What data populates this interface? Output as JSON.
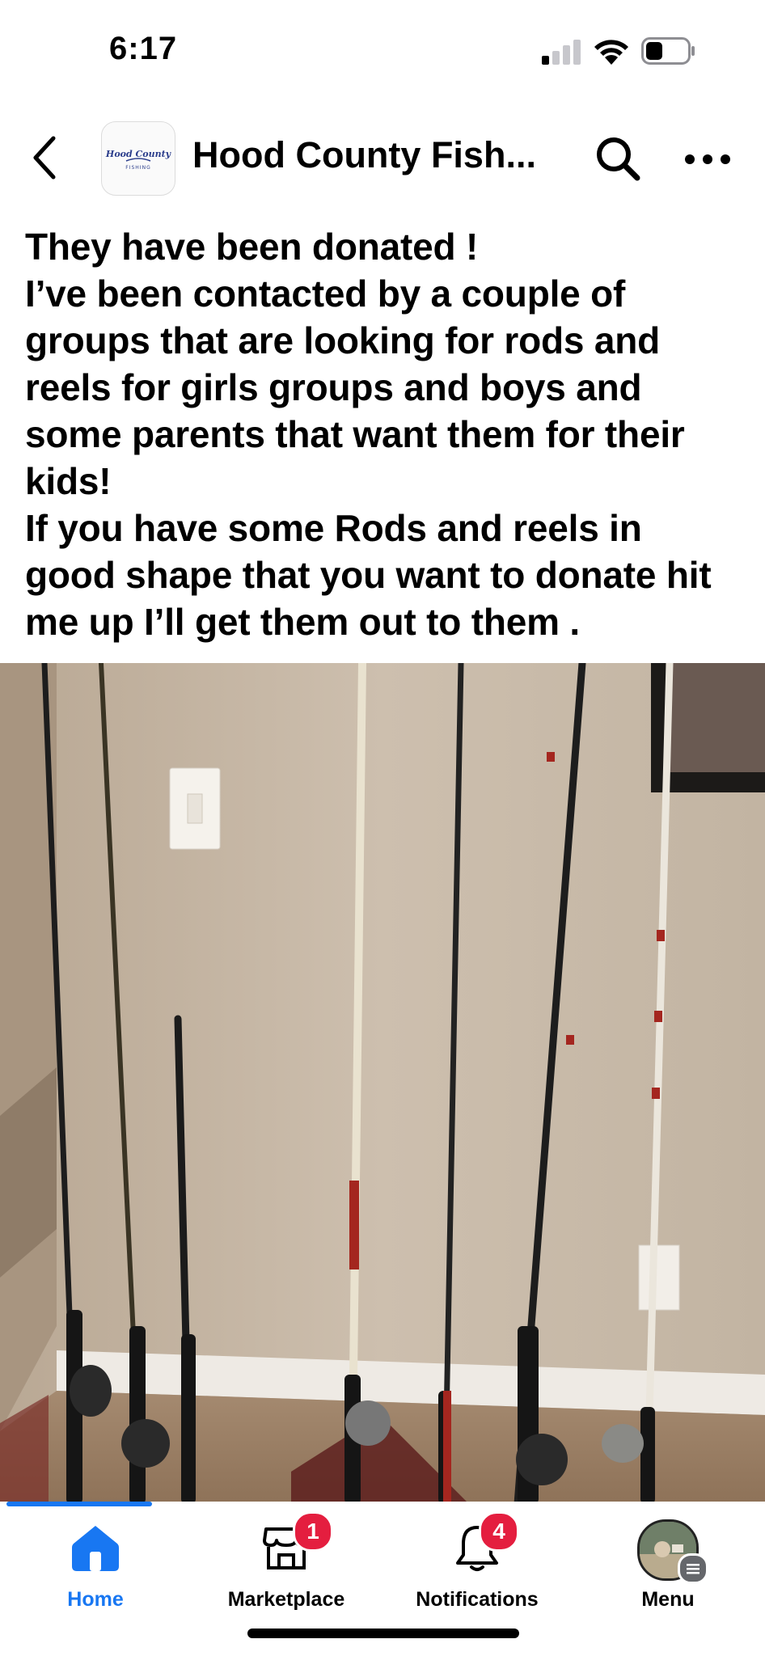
{
  "status_bar": {
    "time": "6:17"
  },
  "header": {
    "group_name": "Hood County Fish...",
    "logo_text_line1": "Hood County",
    "logo_text_line2": "FISHING"
  },
  "post": {
    "text": "They have been donated !\nI’ve been contacted by a couple of groups that are looking for rods and reels for girls groups and boys and some parents that want them for their kids!\nIf you have some Rods and reels in good shape that you want to donate hit me up I’ll get them out to them .",
    "photo_description_icon": "fishing-rods-photo",
    "photo_progress": 0.19
  },
  "tab_bar": {
    "tabs": [
      {
        "label": "Home",
        "icon": "home-icon",
        "active": true
      },
      {
        "label": "Marketplace",
        "icon": "marketplace-icon",
        "badge": "1"
      },
      {
        "label": "Notifications",
        "icon": "bell-icon",
        "badge": "4"
      },
      {
        "label": "Menu",
        "icon": "avatar-icon"
      }
    ]
  },
  "colors": {
    "accent": "#1877f2",
    "badge": "#e41e3f"
  }
}
